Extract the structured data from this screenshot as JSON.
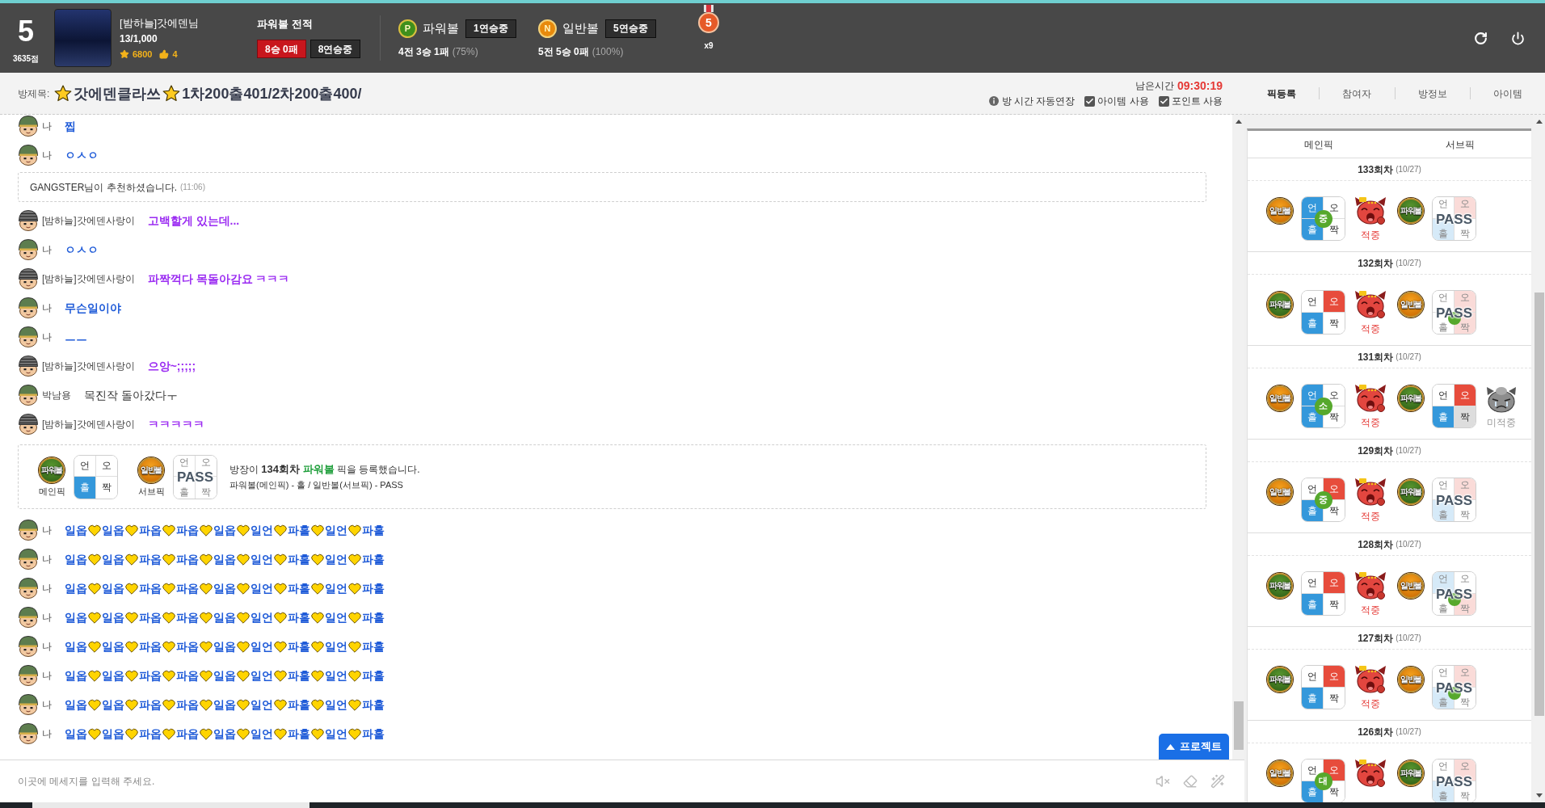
{
  "header": {
    "rank": "5",
    "points": "3635점",
    "nickname": "[밤하늘]갓에덴님",
    "exp": "13/1,000",
    "score": "6800",
    "likes": "4",
    "record": {
      "title": "파워볼 전적",
      "result": "8승 0패",
      "streak": "8연승중"
    },
    "balls": [
      {
        "kind": "power",
        "badge": "P",
        "name": "파워볼",
        "streak": "1연승중",
        "summary": "4전 3승 1패",
        "rate": "(75%)"
      },
      {
        "kind": "normal",
        "badge": "N",
        "name": "일반볼",
        "streak": "5연승중",
        "summary": "5전 5승 0패",
        "rate": "(100%)"
      }
    ],
    "medal": {
      "number": "5",
      "count": "x9"
    }
  },
  "room": {
    "label": "방제목:",
    "title_parts": [
      "갓에덴클라쓰",
      "1차200출401/2차200출400/"
    ],
    "time_label": "남은시간",
    "time": "09:30:19",
    "auto_extend": "방 시간 자동연장",
    "options": [
      {
        "label": "아이템 사용",
        "checked": true
      },
      {
        "label": "포인트 사용",
        "checked": true
      }
    ]
  },
  "tabs": [
    {
      "label": "픽등록",
      "selected": true
    },
    {
      "label": "참여자",
      "selected": false
    },
    {
      "label": "방정보",
      "selected": false
    },
    {
      "label": "아이템",
      "selected": false
    }
  ],
  "chat": {
    "messages": [
      {
        "kind": "chat",
        "avatar": {
          "kind": "helmet"
        },
        "sender": "나",
        "text": "찝",
        "color": "#1f5bd8",
        "bold": true
      },
      {
        "kind": "chat",
        "avatar": {
          "kind": "helmet"
        },
        "sender": "나",
        "text": "ㅇㅅㅇ",
        "color": "#1f5bd8",
        "bold": true
      },
      {
        "kind": "notice",
        "text": "GANGSTER님이 추천하셨습니다.",
        "time": "(11:06)"
      },
      {
        "kind": "chat",
        "avatar": {
          "kind": "striped_helmet"
        },
        "sender": "[밤하늘]갓에덴사랑이",
        "text": "고백할게 있는데...",
        "color": "#9b2cf2",
        "bold": true
      },
      {
        "kind": "chat",
        "avatar": {
          "kind": "helmet"
        },
        "sender": "나",
        "text": "ㅇㅅㅇ",
        "color": "#1f5bd8",
        "bold": true
      },
      {
        "kind": "chat",
        "avatar": {
          "kind": "striped_helmet"
        },
        "sender": "[밤하늘]갓에덴사랑이",
        "text": "파짝꺽다 목돌아감요 ㅋㅋㅋ",
        "color": "#9b2cf2",
        "bold": true
      },
      {
        "kind": "chat",
        "avatar": {
          "kind": "helmet"
        },
        "sender": "나",
        "text": "무슨일이야",
        "color": "#1f5bd8",
        "bold": true
      },
      {
        "kind": "chat",
        "avatar": {
          "kind": "helmet"
        },
        "sender": "나",
        "text": "ㅡㅡ",
        "color": "#1f5bd8",
        "bold": true
      },
      {
        "kind": "chat",
        "avatar": {
          "kind": "striped_helmet"
        },
        "sender": "[밤하늘]갓에덴사랑이",
        "text": "으앙~;;;;;",
        "color": "#9b2cf2",
        "bold": true
      },
      {
        "kind": "chat",
        "avatar": {
          "kind": "helmet"
        },
        "sender": "박남용",
        "text": "목진작 돌아갔다ㅜ",
        "color": "#333333",
        "bold": false
      },
      {
        "kind": "chat",
        "avatar": {
          "kind": "striped_helmet"
        },
        "sender": "[밤하늘]갓에덴사랑이",
        "text": "ㅋㅋㅋㅋㅋ",
        "color": "#9b2cf2",
        "bold": true
      },
      {
        "kind": "pick",
        "main": {
          "ball": {
            "kind": "power",
            "label": "파워볼"
          },
          "caption": "메인픽",
          "cells": [
            {
              "label": "언",
              "color": "#ffffff"
            },
            {
              "label": "오",
              "color": "#ffffff"
            },
            {
              "label": "홀",
              "color": "#3498db"
            },
            {
              "label": "짝",
              "color": "#ffffff"
            }
          ]
        },
        "sub": {
          "ball": {
            "kind": "normal",
            "label": "일반볼"
          },
          "caption": "서브픽",
          "cells": [
            {
              "label": "언",
              "color": "#ffffff"
            },
            {
              "label": "오",
              "color": "#ffffff"
            },
            {
              "label": "홀",
              "color": "#ffffff"
            },
            {
              "label": "짝",
              "color": "#ffffff"
            }
          ],
          "overlay": "PASS"
        },
        "segments": [
          {
            "text": "방장이 ",
            "bold": false
          },
          {
            "text": "134회차 ",
            "bold": true
          },
          {
            "text": "파워볼",
            "bold": true,
            "color": "#1e9e3a"
          },
          {
            "text": " 픽을 등록했습니다.",
            "bold": false
          }
        ],
        "detail": "파워볼(메인픽) - 홀 / 일반볼(서브픽) - PASS"
      },
      {
        "kind": "chat",
        "avatar": {
          "kind": "helmet"
        },
        "sender": "나",
        "parts": [
          "일옵",
          "일옵",
          "파옵",
          "파옵",
          "일옵",
          "일언",
          "파홀",
          "일언",
          "파홀"
        ],
        "color": "#1f5bd8",
        "bold": true
      },
      {
        "kind": "chat",
        "avatar": {
          "kind": "helmet"
        },
        "sender": "나",
        "parts": [
          "일옵",
          "일옵",
          "파옵",
          "파옵",
          "일옵",
          "일언",
          "파홀",
          "일언",
          "파홀"
        ],
        "color": "#1f5bd8",
        "bold": true
      },
      {
        "kind": "chat",
        "avatar": {
          "kind": "helmet"
        },
        "sender": "나",
        "parts": [
          "일옵",
          "일옵",
          "파옵",
          "파옵",
          "일옵",
          "일언",
          "파홀",
          "일언",
          "파홀"
        ],
        "color": "#1f5bd8",
        "bold": true
      },
      {
        "kind": "chat",
        "avatar": {
          "kind": "helmet"
        },
        "sender": "나",
        "parts": [
          "일옵",
          "일옵",
          "파옵",
          "파옵",
          "일옵",
          "일언",
          "파홀",
          "일언",
          "파홀"
        ],
        "color": "#1f5bd8",
        "bold": true
      },
      {
        "kind": "chat",
        "avatar": {
          "kind": "helmet"
        },
        "sender": "나",
        "parts": [
          "일옵",
          "일옵",
          "파옵",
          "파옵",
          "일옵",
          "일언",
          "파홀",
          "일언",
          "파홀"
        ],
        "color": "#1f5bd8",
        "bold": true
      },
      {
        "kind": "chat",
        "avatar": {
          "kind": "helmet"
        },
        "sender": "나",
        "parts": [
          "일옵",
          "일옵",
          "파옵",
          "파옵",
          "일옵",
          "일언",
          "파홀",
          "일언",
          "파홀"
        ],
        "color": "#1f5bd8",
        "bold": true
      },
      {
        "kind": "chat",
        "avatar": {
          "kind": "helmet"
        },
        "sender": "나",
        "parts": [
          "일옵",
          "일옵",
          "파옵",
          "파옵",
          "일옵",
          "일언",
          "파홀",
          "일언",
          "파홀"
        ],
        "color": "#1f5bd8",
        "bold": true
      },
      {
        "kind": "chat",
        "avatar": {
          "kind": "helmet"
        },
        "sender": "나",
        "parts": [
          "일옵",
          "일옵",
          "파옵",
          "파옵",
          "일옵",
          "일언",
          "파홀",
          "일언",
          "파홀"
        ],
        "color": "#1f5bd8",
        "bold": true
      }
    ],
    "project_button": "프로젝트",
    "input": {
      "placeholder": "이곳에 메세지를 입력해 주세요."
    }
  },
  "picks_panel": {
    "columns": [
      "메인픽",
      "서브픽"
    ],
    "rounds": [
      {
        "round": "133회차",
        "date": "(10/27)",
        "main": {
          "ball": {
            "kind": "normal",
            "label": "일반볼"
          },
          "cells": [
            {
              "label": "언",
              "color": "#3498db"
            },
            {
              "label": "오",
              "color": "#ffffff"
            },
            {
              "label": "홀",
              "color": "#3498db"
            },
            {
              "label": "짝",
              "color": "#ffffff"
            }
          ],
          "size_mark": "중",
          "result": {
            "label": "적중",
            "hit": true
          }
        },
        "sub": {
          "ball": {
            "kind": "power",
            "label": "파워볼"
          },
          "cells": [
            {
              "label": "언",
              "color": "#ffffff"
            },
            {
              "label": "오",
              "color": "#fadbd8"
            },
            {
              "label": "홀",
              "color": "#d6eaf8"
            },
            {
              "label": "짝",
              "color": "#ffffff"
            }
          ],
          "overlay": "PASS"
        }
      },
      {
        "round": "132회차",
        "date": "(10/27)",
        "main": {
          "ball": {
            "kind": "power",
            "label": "파워볼"
          },
          "cells": [
            {
              "label": "언",
              "color": "#ffffff"
            },
            {
              "label": "오",
              "color": "#e74c3c"
            },
            {
              "label": "홀",
              "color": "#3498db"
            },
            {
              "label": "짝",
              "color": "#ffffff"
            }
          ],
          "result": {
            "label": "적중",
            "hit": true
          }
        },
        "sub": {
          "ball": {
            "kind": "normal",
            "label": "일반볼"
          },
          "cells": [
            {
              "label": "언",
              "color": "#ffffff"
            },
            {
              "label": "오",
              "color": "#fadbd8"
            },
            {
              "label": "홀",
              "color": "#ffffff"
            },
            {
              "label": "짝",
              "color": "#fadbd8"
            }
          ],
          "overlay": "PASS",
          "dot": true
        }
      },
      {
        "round": "131회차",
        "date": "(10/27)",
        "main": {
          "ball": {
            "kind": "normal",
            "label": "일반볼"
          },
          "cells": [
            {
              "label": "언",
              "color": "#3498db"
            },
            {
              "label": "오",
              "color": "#ffffff"
            },
            {
              "label": "홀",
              "color": "#3498db"
            },
            {
              "label": "짝",
              "color": "#ffffff"
            }
          ],
          "size_mark": "소",
          "result": {
            "label": "적중",
            "hit": true
          }
        },
        "sub": {
          "ball": {
            "kind": "power",
            "label": "파워볼"
          },
          "cells": [
            {
              "label": "언",
              "color": "#ffffff"
            },
            {
              "label": "오",
              "color": "#e74c3c"
            },
            {
              "label": "홀",
              "color": "#3498db"
            },
            {
              "label": "짝",
              "color": "#dddddd"
            }
          ],
          "result": {
            "label": "미적중",
            "hit": false
          }
        }
      },
      {
        "round": "129회차",
        "date": "(10/27)",
        "main": {
          "ball": {
            "kind": "normal",
            "label": "일반볼"
          },
          "cells": [
            {
              "label": "언",
              "color": "#ffffff"
            },
            {
              "label": "오",
              "color": "#e74c3c"
            },
            {
              "label": "홀",
              "color": "#3498db"
            },
            {
              "label": "짝",
              "color": "#ffffff"
            }
          ],
          "size_mark": "중",
          "result": {
            "label": "적중",
            "hit": true
          }
        },
        "sub": {
          "ball": {
            "kind": "power",
            "label": "파워볼"
          },
          "cells": [
            {
              "label": "언",
              "color": "#ffffff"
            },
            {
              "label": "오",
              "color": "#fadbd8"
            },
            {
              "label": "홀",
              "color": "#d6eaf8"
            },
            {
              "label": "짝",
              "color": "#ffffff"
            }
          ],
          "overlay": "PASS"
        }
      },
      {
        "round": "128회차",
        "date": "(10/27)",
        "main": {
          "ball": {
            "kind": "power",
            "label": "파워볼"
          },
          "cells": [
            {
              "label": "언",
              "color": "#ffffff"
            },
            {
              "label": "오",
              "color": "#e74c3c"
            },
            {
              "label": "홀",
              "color": "#3498db"
            },
            {
              "label": "짝",
              "color": "#ffffff"
            }
          ],
          "result": {
            "label": "적중",
            "hit": true
          }
        },
        "sub": {
          "ball": {
            "kind": "normal",
            "label": "일반볼"
          },
          "cells": [
            {
              "label": "언",
              "color": "#d6eaf8"
            },
            {
              "label": "오",
              "color": "#ffffff"
            },
            {
              "label": "홀",
              "color": "#ffffff"
            },
            {
              "label": "짝",
              "color": "#fadbd8"
            }
          ],
          "overlay": "PASS",
          "dot": true
        }
      },
      {
        "round": "127회차",
        "date": "(10/27)",
        "main": {
          "ball": {
            "kind": "power",
            "label": "파워볼"
          },
          "cells": [
            {
              "label": "언",
              "color": "#ffffff"
            },
            {
              "label": "오",
              "color": "#e74c3c"
            },
            {
              "label": "홀",
              "color": "#3498db"
            },
            {
              "label": "짝",
              "color": "#ffffff"
            }
          ],
          "result": {
            "label": "적중",
            "hit": true
          }
        },
        "sub": {
          "ball": {
            "kind": "normal",
            "label": "일반볼"
          },
          "cells": [
            {
              "label": "언",
              "color": "#ffffff"
            },
            {
              "label": "오",
              "color": "#fadbd8"
            },
            {
              "label": "홀",
              "color": "#d6eaf8"
            },
            {
              "label": "짝",
              "color": "#ffffff"
            }
          ],
          "overlay": "PASS",
          "dot": true
        }
      },
      {
        "round": "126회차",
        "date": "(10/27)",
        "main": {
          "ball": {
            "kind": "normal",
            "label": "일반볼"
          },
          "cells": [
            {
              "label": "언",
              "color": "#ffffff"
            },
            {
              "label": "오",
              "color": "#e74c3c"
            },
            {
              "label": "홀",
              "color": "#3498db"
            },
            {
              "label": "짝",
              "color": "#ffffff"
            }
          ],
          "size_mark": "대",
          "result": {
            "hit": true
          }
        },
        "sub": {
          "ball": {
            "kind": "power",
            "label": "파워볼"
          },
          "cells": [
            {
              "label": "언",
              "color": "#ffffff"
            },
            {
              "label": "오",
              "color": "#fadbd8"
            },
            {
              "label": "홀",
              "color": "#d6eaf8"
            },
            {
              "label": "짝",
              "color": "#ffffff"
            }
          ],
          "overlay": "PASS"
        }
      }
    ]
  }
}
